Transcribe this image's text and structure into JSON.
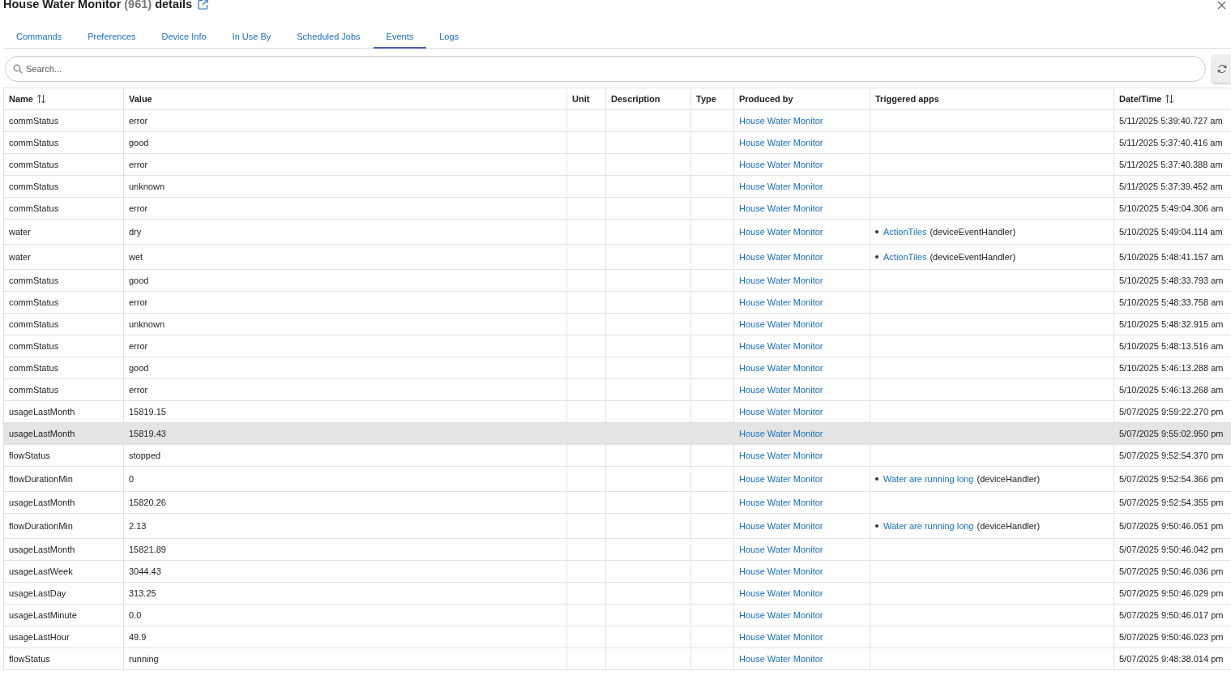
{
  "header": {
    "title": "House Water Monitor",
    "device_id": "(961)",
    "suffix": "details"
  },
  "tabs": [
    {
      "label": "Commands",
      "selected": false
    },
    {
      "label": "Preferences",
      "selected": false
    },
    {
      "label": "Device Info",
      "selected": false
    },
    {
      "label": "In Use By",
      "selected": false
    },
    {
      "label": "Scheduled Jobs",
      "selected": false
    },
    {
      "label": "Events",
      "selected": true
    },
    {
      "label": "Logs",
      "selected": false
    }
  ],
  "search": {
    "placeholder": "Search..."
  },
  "table": {
    "columns": [
      {
        "label": "Name",
        "sortable": true
      },
      {
        "label": "Value",
        "sortable": false
      },
      {
        "label": "Unit",
        "sortable": false
      },
      {
        "label": "Description",
        "sortable": false
      },
      {
        "label": "Type",
        "sortable": false
      },
      {
        "label": "Produced by",
        "sortable": false
      },
      {
        "label": "Triggered apps",
        "sortable": false
      },
      {
        "label": "Date/Time",
        "sortable": true
      }
    ],
    "rows": [
      {
        "name": "commStatus",
        "value": "error",
        "produced_by": "House Water Monitor",
        "triggered": [],
        "datetime": "5/11/2025 5:39:40.727 am",
        "highlighted": false
      },
      {
        "name": "commStatus",
        "value": "good",
        "produced_by": "House Water Monitor",
        "triggered": [],
        "datetime": "5/11/2025 5:37:40.416 am",
        "highlighted": false
      },
      {
        "name": "commStatus",
        "value": "error",
        "produced_by": "House Water Monitor",
        "triggered": [],
        "datetime": "5/11/2025 5:37:40.388 am",
        "highlighted": false
      },
      {
        "name": "commStatus",
        "value": "unknown",
        "produced_by": "House Water Monitor",
        "triggered": [],
        "datetime": "5/11/2025 5:37:39.452 am",
        "highlighted": false
      },
      {
        "name": "commStatus",
        "value": "error",
        "produced_by": "House Water Monitor",
        "triggered": [],
        "datetime": "5/10/2025 5:49:04.306 am",
        "highlighted": false
      },
      {
        "name": "water",
        "value": "dry",
        "produced_by": "House Water Monitor",
        "triggered": [
          {
            "app": "ActionTiles",
            "handler": "(deviceEventHandler)"
          }
        ],
        "datetime": "5/10/2025 5:49:04.114 am",
        "highlighted": false
      },
      {
        "name": "water",
        "value": "wet",
        "produced_by": "House Water Monitor",
        "triggered": [
          {
            "app": "ActionTiles",
            "handler": "(deviceEventHandler)"
          }
        ],
        "datetime": "5/10/2025 5:48:41.157 am",
        "highlighted": false
      },
      {
        "name": "commStatus",
        "value": "good",
        "produced_by": "House Water Monitor",
        "triggered": [],
        "datetime": "5/10/2025 5:48:33.793 am",
        "highlighted": false
      },
      {
        "name": "commStatus",
        "value": "error",
        "produced_by": "House Water Monitor",
        "triggered": [],
        "datetime": "5/10/2025 5:48:33.758 am",
        "highlighted": false
      },
      {
        "name": "commStatus",
        "value": "unknown",
        "produced_by": "House Water Monitor",
        "triggered": [],
        "datetime": "5/10/2025 5:48:32.915 am",
        "highlighted": false
      },
      {
        "name": "commStatus",
        "value": "error",
        "produced_by": "House Water Monitor",
        "triggered": [],
        "datetime": "5/10/2025 5:48:13.516 am",
        "highlighted": false
      },
      {
        "name": "commStatus",
        "value": "good",
        "produced_by": "House Water Monitor",
        "triggered": [],
        "datetime": "5/10/2025 5:46:13.288 am",
        "highlighted": false
      },
      {
        "name": "commStatus",
        "value": "error",
        "produced_by": "House Water Monitor",
        "triggered": [],
        "datetime": "5/10/2025 5:46:13.268 am",
        "highlighted": false
      },
      {
        "name": "usageLastMonth",
        "value": "15819.15",
        "produced_by": "House Water Monitor",
        "triggered": [],
        "datetime": "5/07/2025 9:59:22.270 pm",
        "highlighted": false
      },
      {
        "name": "usageLastMonth",
        "value": "15819.43",
        "produced_by": "House Water Monitor",
        "triggered": [],
        "datetime": "5/07/2025 9:55:02.950 pm",
        "highlighted": true
      },
      {
        "name": "flowStatus",
        "value": "stopped",
        "produced_by": "House Water Monitor",
        "triggered": [],
        "datetime": "5/07/2025 9:52:54.370 pm",
        "highlighted": false
      },
      {
        "name": "flowDurationMin",
        "value": "0",
        "produced_by": "House Water Monitor",
        "triggered": [
          {
            "app": "Water are running long",
            "handler": "(deviceHandler)"
          }
        ],
        "datetime": "5/07/2025 9:52:54.366 pm",
        "highlighted": false
      },
      {
        "name": "usageLastMonth",
        "value": "15820.26",
        "produced_by": "House Water Monitor",
        "triggered": [],
        "datetime": "5/07/2025 9:52:54.355 pm",
        "highlighted": false
      },
      {
        "name": "flowDurationMin",
        "value": "2.13",
        "produced_by": "House Water Monitor",
        "triggered": [
          {
            "app": "Water are running long",
            "handler": "(deviceHandler)"
          }
        ],
        "datetime": "5/07/2025 9:50:46.051 pm",
        "highlighted": false
      },
      {
        "name": "usageLastMonth",
        "value": "15821.89",
        "produced_by": "House Water Monitor",
        "triggered": [],
        "datetime": "5/07/2025 9:50:46.042 pm",
        "highlighted": false
      },
      {
        "name": "usageLastWeek",
        "value": "3044.43",
        "produced_by": "House Water Monitor",
        "triggered": [],
        "datetime": "5/07/2025 9:50:46.036 pm",
        "highlighted": false
      },
      {
        "name": "usageLastDay",
        "value": "313.25",
        "produced_by": "House Water Monitor",
        "triggered": [],
        "datetime": "5/07/2025 9:50:46.029 pm",
        "highlighted": false
      },
      {
        "name": "usageLastMinute",
        "value": "0.0",
        "produced_by": "House Water Monitor",
        "triggered": [],
        "datetime": "5/07/2025 9:50:46.017 pm",
        "highlighted": false
      },
      {
        "name": "usageLastHour",
        "value": "49.9",
        "produced_by": "House Water Monitor",
        "triggered": [],
        "datetime": "5/07/2025 9:50:46.023 pm",
        "highlighted": false
      },
      {
        "name": "flowStatus",
        "value": "running",
        "produced_by": "House Water Monitor",
        "triggered": [],
        "datetime": "5/07/2025 9:48:38.014 pm",
        "highlighted": false
      }
    ]
  }
}
